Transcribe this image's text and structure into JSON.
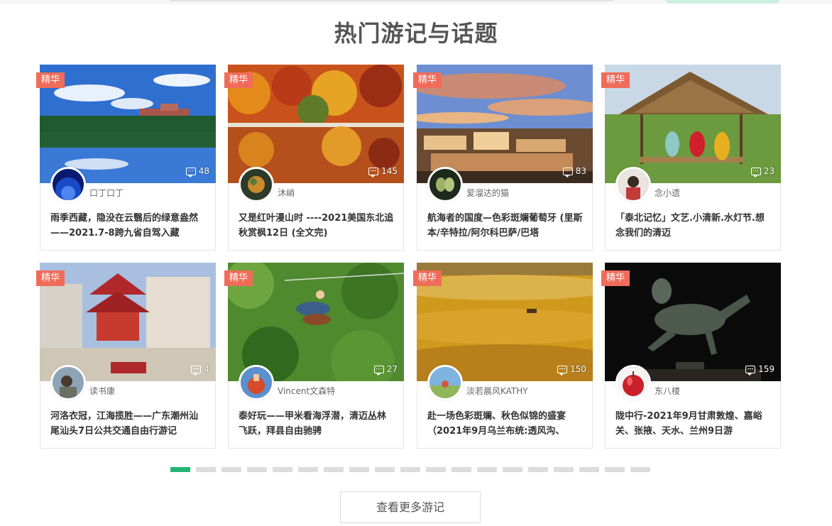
{
  "section": {
    "title": "热门游记与话题",
    "badge": "精华",
    "more_button": "查看更多游记"
  },
  "colors": {
    "accent": "#22b573",
    "badge": "#f06c5a"
  },
  "cards": [
    {
      "author": "口丁口丁",
      "comments": "48",
      "title": "雨季西藏，隐没在云翳后的绿意盎然——2021.7-8跨九省自驾入藏"
    },
    {
      "author": "沐峭",
      "comments": "145",
      "title": "又是红叶漫山时 ----2021美国东北追秋赏枫12日 (全文完)"
    },
    {
      "author": "爱溜达的猫",
      "comments": "83",
      "title": "航海者的国度—色彩斑斓葡萄牙 (里斯本/辛特拉/阿尔科巴萨/巴塔"
    },
    {
      "author": "念小遗",
      "comments": "23",
      "title": "「泰北记忆」文艺.小清新.水灯节.想念我们的清迈"
    },
    {
      "author": "读书康",
      "comments": "4",
      "title": "河洛衣冠，江海揽胜——广东潮州汕尾汕头7日公共交通自由行游记"
    },
    {
      "author": "Vincent文森特",
      "comments": "27",
      "title": "泰好玩——甲米看海浮潜，清迈丛林飞跃，拜县自由驰骋"
    },
    {
      "author": "淡若晨风KATHY",
      "comments": "150",
      "title": "赴一场色彩斑斓、秋色似锦的盛宴（2021年9月乌兰布统:透风沟、"
    },
    {
      "author": "东八楼",
      "comments": "159",
      "title": "陇中行-2021年9月甘肃敦煌、嘉峪关、张掖、天水、兰州9日游"
    }
  ],
  "pager": {
    "total": 19,
    "active": 1
  }
}
